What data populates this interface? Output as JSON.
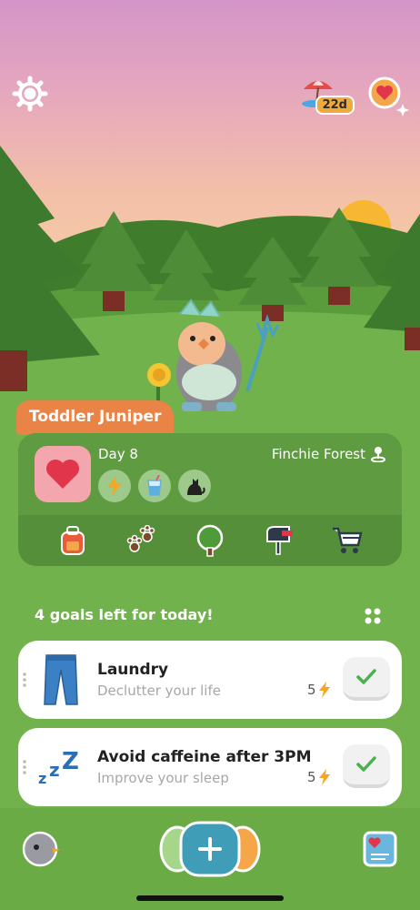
{
  "header": {
    "vacation_days": "22d"
  },
  "pet": {
    "name": "Toddler Juniper",
    "day_label": "Day 8",
    "location": "Finchie Forest"
  },
  "status_icons": [
    "energy-icon",
    "drink-icon",
    "cat-icon"
  ],
  "nav_icons": [
    "backpack-icon",
    "paw-prints-icon",
    "tree-icon",
    "mailbox-icon",
    "shopping-cart-icon"
  ],
  "goals_section": {
    "title": "4 goals left for today!"
  },
  "goals": [
    {
      "title": "Laundry",
      "subtitle": "Declutter your life",
      "reward": "5",
      "icon": "jeans-icon"
    },
    {
      "title": "Avoid caffeine after 3PM",
      "subtitle": "Improve your sleep",
      "reward": "5",
      "icon": "zzz-icon"
    }
  ],
  "colors": {
    "accent_orange": "#e98446",
    "heart_red": "#e0354a",
    "check_green": "#4caf50",
    "add_teal": "#3f9db8"
  }
}
